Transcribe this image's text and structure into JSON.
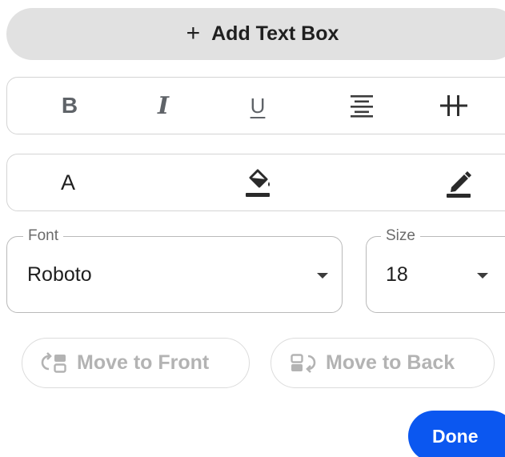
{
  "add_text_box": {
    "icon": "plus-icon",
    "label": "Add Text Box"
  },
  "format_toolbar": {
    "bold": "B",
    "italic": "I",
    "underline": "U",
    "icons": [
      "bold-icon",
      "italic-icon",
      "underline-icon",
      "align-center-icon",
      "letter-spacing-icon"
    ]
  },
  "color_toolbar": {
    "text_color": "A",
    "icons": [
      "text-color-icon",
      "fill-color-icon",
      "border-color-icon"
    ]
  },
  "font_field": {
    "label": "Font",
    "value": "Roboto"
  },
  "size_field": {
    "label": "Size",
    "value": "18"
  },
  "arrange": {
    "move_to_front": "Move to Front",
    "move_to_back": "Move to Back"
  },
  "done_label": "Done",
  "colors": {
    "accent": "#0b57f0",
    "button_bg": "#e1e1e1",
    "disabled_text": "#b3b3b3"
  }
}
